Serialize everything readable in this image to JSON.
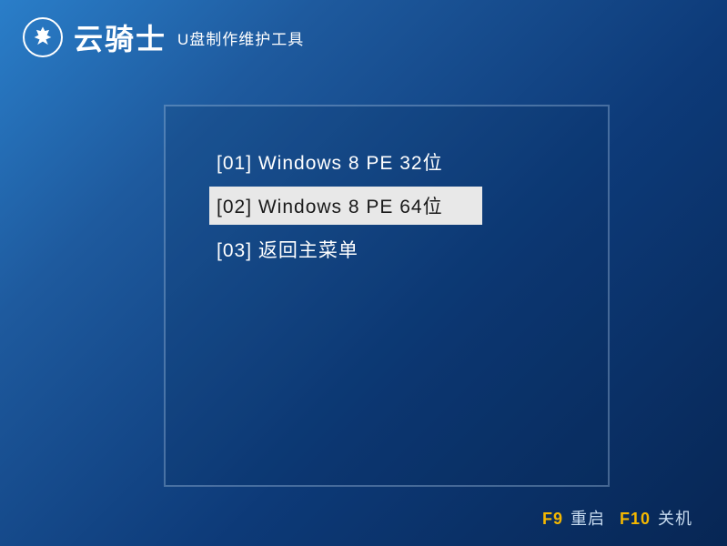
{
  "header": {
    "brand": "云骑士",
    "subtitle": "U盘制作维护工具"
  },
  "menu": {
    "items": [
      {
        "label": "[01] Windows 8 PE 32位",
        "selected": false
      },
      {
        "label": "[02] Windows 8 PE 64位",
        "selected": true
      },
      {
        "label": "[03] 返回主菜单",
        "selected": false
      }
    ]
  },
  "footer": {
    "f9_key": "F9",
    "f9_label": "重启",
    "f10_key": "F10",
    "f10_label": "关机"
  }
}
